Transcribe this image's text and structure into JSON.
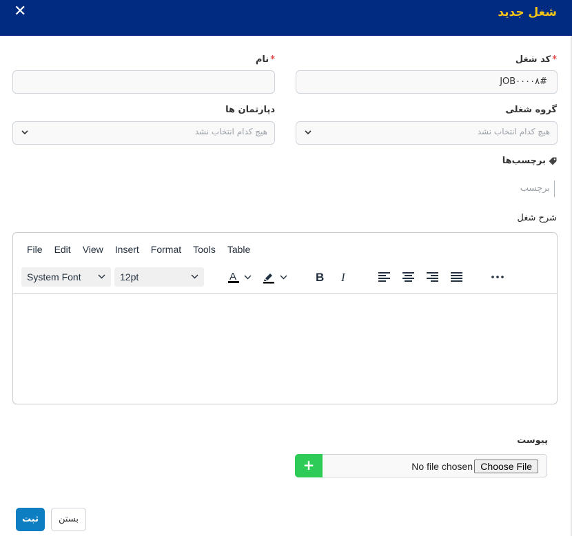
{
  "modal": {
    "title": "شغل جدید",
    "close_symbol": "✕"
  },
  "form": {
    "job_code": {
      "label": "کد شغل",
      "required_mark": "*",
      "value": "#JOB٠٠٠٠٨"
    },
    "name": {
      "label": "نام",
      "required_mark": "*",
      "value": ""
    },
    "job_group": {
      "label": "گروه شغلی",
      "placeholder": "هیچ کدام انتخاب نشد"
    },
    "department": {
      "label": "دپارتمان ها",
      "placeholder": "هیچ کدام انتخاب نشد"
    },
    "tags": {
      "label": "برچسب‌ها",
      "placeholder": "برچسب",
      "icon": "tag-icon"
    },
    "description": {
      "label": "شرح شغل"
    }
  },
  "editor": {
    "menu": [
      "File",
      "Edit",
      "View",
      "Insert",
      "Format",
      "Tools",
      "Table"
    ],
    "font_family": "System Font",
    "font_size": "12pt",
    "toolbar_icons": [
      "text-color-icon",
      "highlight-color-icon",
      "bold-icon",
      "italic-icon",
      "align-left-icon",
      "align-center-icon",
      "align-right-icon",
      "align-justify-icon",
      "more-icon"
    ]
  },
  "attachment": {
    "label": "پیوست",
    "add_symbol": "+",
    "no_file_text": "No file chosen",
    "choose_label": "Choose File"
  },
  "actions": {
    "submit_label": "ثبت",
    "close_label": "بستن"
  },
  "colors": {
    "header_bg": "#002b80",
    "title": "#f5c518",
    "submit": "#0d7ec1",
    "add": "#2ecc57"
  }
}
